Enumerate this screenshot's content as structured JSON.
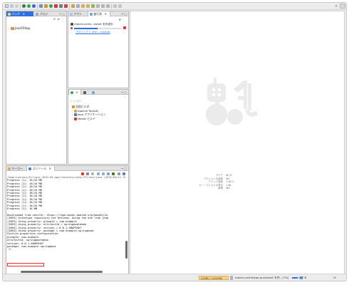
{
  "toolbar": {
    "search_glyph": "⌕"
  },
  "package_explorer": {
    "tabs": [
      {
        "label": "パッケ"
      },
      {
        "label": "プロジ"
      }
    ],
    "tree": [
      {
        "label": "JavaFXApp"
      }
    ]
  },
  "progress_view": {
    "tabs": [
      {
        "label": "アウト"
      },
      {
        "label": "進行状"
      }
    ],
    "job_title": "maven-arche...kstart を作成中",
    "job_link": "プロジェクト mvn:...ickstart"
  },
  "palette_view": {
    "filter_placeholder": "フィルター",
    "items": [
      {
        "label": "汎用ビルダ"
      },
      {
        "label": "Apache Tomcat"
      },
      {
        "label": "Java アプリケーション"
      },
      {
        "label": "Maven ビルド"
      }
    ]
  },
  "console_view": {
    "tabs": [
      {
        "label": "マーカー"
      },
      {
        "label": "コンソール"
      }
    ],
    "lines": [
      "/Applications/Eclipse_2019-03.app/Contents/Java/JTI/bin/java (2019/03/12 13:02:53)",
      "Progress (1): 16/16 MB",
      "Progress (1): 16/16 MB",
      "Progress (1): 16/16 MB",
      "Progress (1): 16/16 MB",
      "Progress (1): 16/16 MB",
      "Progress (1): 16/16 MB",
      "Progress (1): 16/16 MB",
      "Progress (1): 16/16 MB",
      "Progress (1): 16/16 MB",
      "Progress (1): 16 MB",
      "",
      "Downloaded from central: https://repo.maven.apache.org/maven2/ar",
      "[INFO] Archetype repository not defined. Using the one from [com",
      "[INFO] Using property: groupId = com.example",
      "[INFO] Using property: artifactId = springbootdemo",
      "[INFO] Using property: version = 0.0.1-SNAPSHOT",
      "[INFO] Using property: package = com.example.springboot",
      "Confirm properties configuration:",
      "groupId: com.example",
      "artifactId: springbootdemo",
      "version: 0.0.1-SNAPSHOT",
      "package: com.example.springboot",
      " Y: "
    ]
  },
  "editor": {
    "shortcuts": [
      {
        "label": "すべて",
        "key": "⌘⇧R"
      },
      {
        "label": "アクションの検索",
        "key": "⌘3"
      },
      {
        "label": "クイック検索",
        "key": "⌥⌘⇧L"
      },
      {
        "label": "キー・アシストの表示",
        "key": "⇧⌘L"
      },
      {
        "label": "新規",
        "key": "⌘N"
      }
    ]
  },
  "status_bar": {
    "memory": "41MB / 1402MB",
    "job": "maven-archetype-quickstart を作...(7%)",
    "encoding": "UTF-8",
    "line_ending": "LF"
  },
  "colors": {
    "accent": "#2f6fe0",
    "error": "#e53030",
    "logo": "#ebebeb"
  }
}
